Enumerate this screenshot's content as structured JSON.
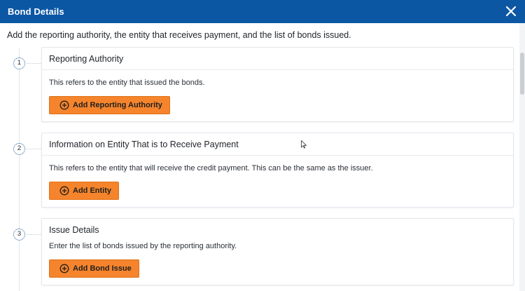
{
  "dialog": {
    "title": "Bond Details",
    "close_icon": "close-icon",
    "intro": "Add the reporting authority, the entity that receives payment, and the list of bonds issued."
  },
  "steps": [
    {
      "number": "1",
      "header": "Reporting Authority",
      "description": "This refers to the entity that issued the bonds.",
      "button_label": "Add Reporting Authority",
      "button_icon": "plus-circle-icon"
    },
    {
      "number": "2",
      "header": "Information on Entity That is to Receive Payment",
      "description": "This refers to the entity that will receive the credit payment. This can be the same as the issuer.",
      "button_label": "Add Entity",
      "button_icon": "plus-circle-icon"
    },
    {
      "number": "3",
      "header": "Issue Details",
      "description": "Enter the list of bonds issued by the reporting authority.",
      "button_label": "Add Bond Issue",
      "button_icon": "plus-circle-icon"
    }
  ],
  "colors": {
    "titlebar": "#0b57a4",
    "button": "#f5842c",
    "step_circle_border": "#1d5fa6"
  }
}
